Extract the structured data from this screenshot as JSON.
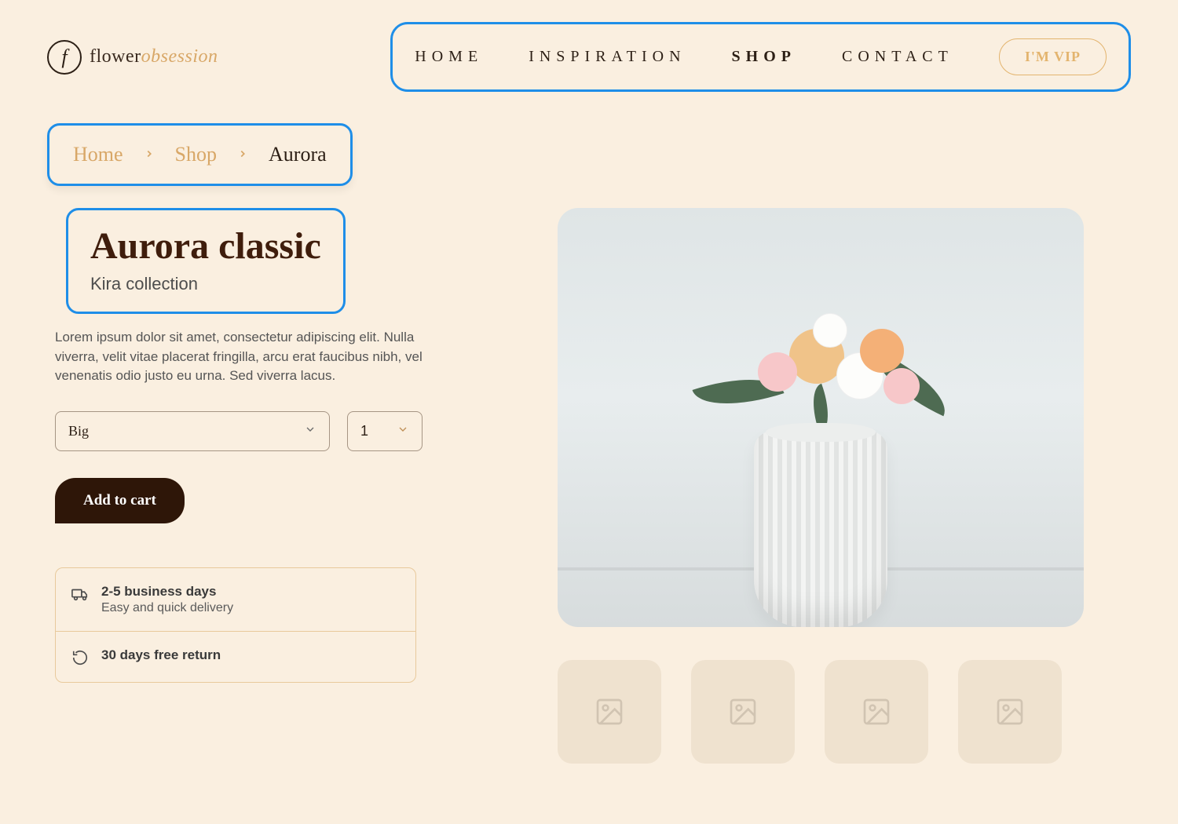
{
  "brand": {
    "part1": "flower",
    "part2": "obsession",
    "mark": "f"
  },
  "nav": {
    "items": [
      "HOME",
      "INSPIRATION",
      "SHOP",
      "CONTACT"
    ],
    "active_index": 2,
    "vip_label": "I'M VIP"
  },
  "breadcrumb": {
    "items": [
      {
        "label": "Home",
        "link": true
      },
      {
        "label": "Shop",
        "link": true
      },
      {
        "label": "Aurora",
        "link": false
      }
    ]
  },
  "product": {
    "title": "Aurora classic",
    "subtitle": "Kira collection",
    "description": "Lorem ipsum dolor sit amet, consectetur adipiscing elit. Nulla viverra, velit vitae placerat fringilla, arcu erat faucibus nibh, vel venenatis odio justo eu urna. Sed viverra lacus.",
    "size_selected": "Big",
    "quantity_selected": "1",
    "add_to_cart_label": "Add to cart"
  },
  "info": {
    "shipping_primary": "2-5 business days",
    "shipping_secondary": "Easy and quick delivery",
    "return_primary": "30 days free return"
  },
  "colors": {
    "accent_blue": "#1e8ee8",
    "accent_gold": "#d8a767",
    "brand_dark": "#2e1608"
  }
}
